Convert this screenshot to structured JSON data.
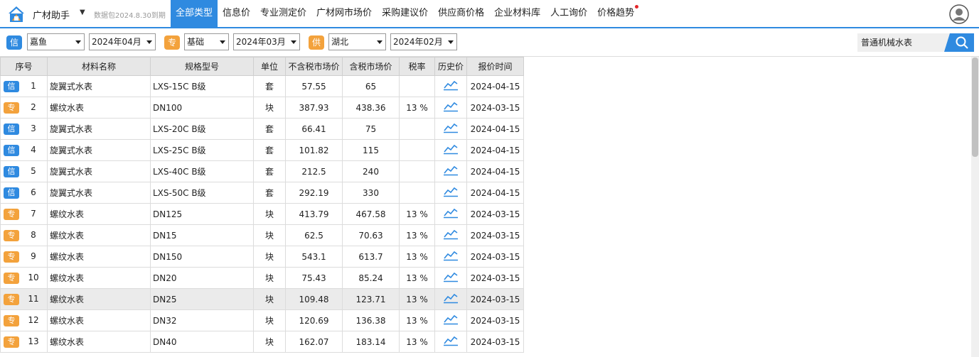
{
  "header": {
    "app_title": "广材助手",
    "data_pack": "数据包2024.8.30到期",
    "nav": [
      {
        "label": "全部类型",
        "active": true
      },
      {
        "label": "信息价"
      },
      {
        "label": "专业测定价"
      },
      {
        "label": "广材网市场价"
      },
      {
        "label": "采购建议价"
      },
      {
        "label": "供应商价格"
      },
      {
        "label": "企业材料库"
      },
      {
        "label": "人工询价"
      },
      {
        "label": "价格趋势",
        "has_dot": true
      }
    ]
  },
  "filters": {
    "info_tag": "信",
    "info_region": "嘉鱼",
    "info_period": "2024年04月",
    "pro_tag": "专",
    "pro_type": "基础",
    "pro_period": "2024年03月",
    "supplier_tag": "供",
    "supplier_region": "湖北",
    "supplier_period": "2024年02月",
    "search_value": "普通机械水表"
  },
  "table": {
    "columns": [
      "序号",
      "材料名称",
      "规格型号",
      "单位",
      "不含税市场价",
      "含税市场价",
      "税率",
      "历史价",
      "报价时间"
    ],
    "rows": [
      {
        "tag": "信",
        "tag_color": "#2f8ae0",
        "no": "1",
        "name": "旋翼式水表",
        "spec": "LXS-15C B级",
        "unit": "套",
        "price_ex": "57.55",
        "price_in": "65",
        "tax": "",
        "date": "2024-04-15"
      },
      {
        "tag": "专",
        "tag_color": "#f3a23c",
        "no": "2",
        "name": "螺纹水表",
        "spec": "DN100",
        "unit": "块",
        "price_ex": "387.93",
        "price_in": "438.36",
        "tax": "13 %",
        "date": "2024-03-15"
      },
      {
        "tag": "信",
        "tag_color": "#2f8ae0",
        "no": "3",
        "name": "旋翼式水表",
        "spec": "LXS-20C B级",
        "unit": "套",
        "price_ex": "66.41",
        "price_in": "75",
        "tax": "",
        "date": "2024-04-15"
      },
      {
        "tag": "信",
        "tag_color": "#2f8ae0",
        "no": "4",
        "name": "旋翼式水表",
        "spec": "LXS-25C B级",
        "unit": "套",
        "price_ex": "101.82",
        "price_in": "115",
        "tax": "",
        "date": "2024-04-15"
      },
      {
        "tag": "信",
        "tag_color": "#2f8ae0",
        "no": "5",
        "name": "旋翼式水表",
        "spec": "LXS-40C B级",
        "unit": "套",
        "price_ex": "212.5",
        "price_in": "240",
        "tax": "",
        "date": "2024-04-15"
      },
      {
        "tag": "信",
        "tag_color": "#2f8ae0",
        "no": "6",
        "name": "旋翼式水表",
        "spec": "LXS-50C B级",
        "unit": "套",
        "price_ex": "292.19",
        "price_in": "330",
        "tax": "",
        "date": "2024-04-15"
      },
      {
        "tag": "专",
        "tag_color": "#f3a23c",
        "no": "7",
        "name": "螺纹水表",
        "spec": "DN125",
        "unit": "块",
        "price_ex": "413.79",
        "price_in": "467.58",
        "tax": "13 %",
        "date": "2024-03-15"
      },
      {
        "tag": "专",
        "tag_color": "#f3a23c",
        "no": "8",
        "name": "螺纹水表",
        "spec": "DN15",
        "unit": "块",
        "price_ex": "62.5",
        "price_in": "70.63",
        "tax": "13 %",
        "date": "2024-03-15"
      },
      {
        "tag": "专",
        "tag_color": "#f3a23c",
        "no": "9",
        "name": "螺纹水表",
        "spec": "DN150",
        "unit": "块",
        "price_ex": "543.1",
        "price_in": "613.7",
        "tax": "13 %",
        "date": "2024-03-15"
      },
      {
        "tag": "专",
        "tag_color": "#f3a23c",
        "no": "10",
        "name": "螺纹水表",
        "spec": "DN20",
        "unit": "块",
        "price_ex": "75.43",
        "price_in": "85.24",
        "tax": "13 %",
        "date": "2024-03-15"
      },
      {
        "tag": "专",
        "tag_color": "#f3a23c",
        "no": "11",
        "name": "螺纹水表",
        "spec": "DN25",
        "unit": "块",
        "price_ex": "109.48",
        "price_in": "123.71",
        "tax": "13 %",
        "date": "2024-03-15",
        "selected": true
      },
      {
        "tag": "专",
        "tag_color": "#f3a23c",
        "no": "12",
        "name": "螺纹水表",
        "spec": "DN32",
        "unit": "块",
        "price_ex": "120.69",
        "price_in": "136.38",
        "tax": "13 %",
        "date": "2024-03-15"
      },
      {
        "tag": "专",
        "tag_color": "#f3a23c",
        "no": "13",
        "name": "螺纹水表",
        "spec": "DN40",
        "unit": "块",
        "price_ex": "162.07",
        "price_in": "183.14",
        "tax": "13 %",
        "date": "2024-03-15"
      }
    ]
  },
  "colors": {
    "accent": "#2f8ae0",
    "pro_tag": "#f3a23c",
    "trend_icon": "#2f8ae0"
  },
  "icons": {
    "logo": "app-logo-icon",
    "avatar": "user-avatar-icon",
    "search": "search-icon",
    "history": "trend-chart-icon"
  }
}
